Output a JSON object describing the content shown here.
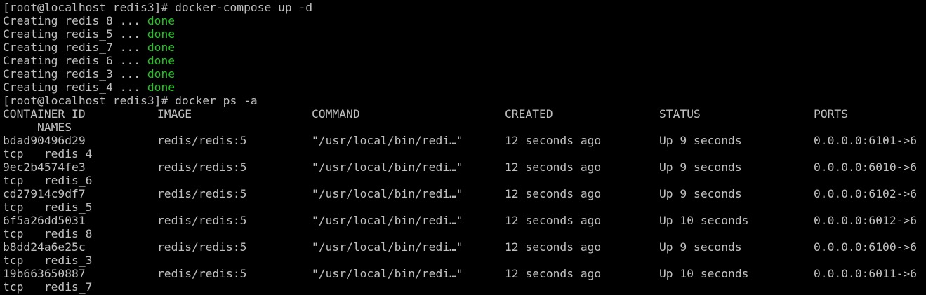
{
  "session": {
    "prompt": "[root@localhost redis3]# ",
    "command1": "docker-compose up -d",
    "command2": "docker ps -a",
    "creating_prefix": "Creating ",
    "creating_suffix": " ... ",
    "done_label": "done"
  },
  "compose_output": [
    {
      "name": "redis_8"
    },
    {
      "name": "redis_5"
    },
    {
      "name": "redis_7"
    },
    {
      "name": "redis_6"
    },
    {
      "name": "redis_3"
    },
    {
      "name": "redis_4"
    }
  ],
  "ps_table": {
    "headers": {
      "container_id": "CONTAINER ID",
      "image": "IMAGE",
      "command": "COMMAND",
      "created": "CREATED",
      "status": "STATUS",
      "ports": "PORTS",
      "names": "     NAMES"
    },
    "rows": [
      {
        "id": "bdad90496d29",
        "image": "redis/redis:5",
        "command": "\"/usr/local/bin/redi…\"",
        "created": "12 seconds ago",
        "status": "Up 9 seconds",
        "ports": "0.0.0.0:6101->6",
        "wrap": "tcp   redis_4"
      },
      {
        "id": "9ec2b4574fe3",
        "image": "redis/redis:5",
        "command": "\"/usr/local/bin/redi…\"",
        "created": "12 seconds ago",
        "status": "Up 9 seconds",
        "ports": "0.0.0.0:6010->6",
        "wrap": "tcp   redis_6"
      },
      {
        "id": "cd27914c9df7",
        "image": "redis/redis:5",
        "command": "\"/usr/local/bin/redi…\"",
        "created": "12 seconds ago",
        "status": "Up 9 seconds",
        "ports": "0.0.0.0:6102->6",
        "wrap": "tcp   redis_5"
      },
      {
        "id": "6f5a26dd5031",
        "image": "redis/redis:5",
        "command": "\"/usr/local/bin/redi…\"",
        "created": "12 seconds ago",
        "status": "Up 10 seconds",
        "ports": "0.0.0.0:6012->6",
        "wrap": "tcp   redis_8"
      },
      {
        "id": "b8dd24a6e25c",
        "image": "redis/redis:5",
        "command": "\"/usr/local/bin/redi…\"",
        "created": "12 seconds ago",
        "status": "Up 9 seconds",
        "ports": "0.0.0.0:6100->6",
        "wrap": "tcp   redis_3"
      },
      {
        "id": "19b663650887",
        "image": "redis/redis:5",
        "command": "\"/usr/local/bin/redi…\"",
        "created": "12 seconds ago",
        "status": "Up 10 seconds",
        "ports": "0.0.0.0:6011->6",
        "wrap": "tcp   redis_7"
      }
    ]
  },
  "colors": {
    "background": "#000000",
    "foreground": "#c0c0c0",
    "success": "#23c423"
  }
}
